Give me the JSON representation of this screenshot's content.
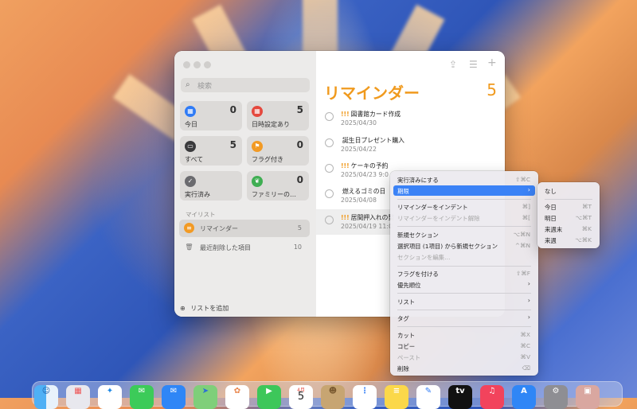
{
  "sidebar": {
    "search_placeholder": "検索",
    "cards": [
      {
        "label": "今日",
        "count": "0",
        "color": "#2f7bf6",
        "icon": "calendar-today-icon"
      },
      {
        "label": "日時設定あり",
        "count": "5",
        "color": "#e5483d",
        "icon": "calendar-icon"
      },
      {
        "label": "すべて",
        "count": "5",
        "color": "#3a3a3c",
        "icon": "tray-icon"
      },
      {
        "label": "フラグ付き",
        "count": "0",
        "color": "#f29a24",
        "icon": "flag-icon"
      },
      {
        "label": "実行済み",
        "count": "",
        "color": "#6b6b6f",
        "icon": "checkmark-icon"
      },
      {
        "label": "ファミリーの…",
        "count": "0",
        "color": "#3fae52",
        "icon": "leaf-icon"
      }
    ],
    "section_title": "マイリスト",
    "lists": [
      {
        "name": "リマインダー",
        "count": "5"
      },
      {
        "name": "最近削除した項目",
        "count": "10"
      }
    ],
    "add_list": "リストを追加"
  },
  "main": {
    "title": "リマインダー",
    "total": "5",
    "tasks": [
      {
        "priority": "!!!",
        "name": "図書館カード作成",
        "date": "2025/04/30"
      },
      {
        "priority": "",
        "name": "誕生日プレゼント購入",
        "date": "2025/04/22"
      },
      {
        "priority": "!!!",
        "name": "ケーキの予約",
        "date": "2025/04/23 9:0"
      },
      {
        "priority": "",
        "name": "燃えるゴミの日",
        "date": "2025/04/08"
      },
      {
        "priority": "!!!",
        "name": "居間押入れの整",
        "date": "2025/04/19 11:0"
      }
    ]
  },
  "context_menu": {
    "items": [
      {
        "label": "実行済みにする",
        "shortcut": "⇧⌘C"
      },
      {
        "label": "期限",
        "submenu": true
      },
      {
        "label": "リマインダーをインデント",
        "shortcut": "⌘]"
      },
      {
        "label": "リマインダーをインデント解除",
        "shortcut": "⌘[",
        "disabled": true
      },
      {
        "label": "新規セクション",
        "shortcut": "⌥⌘N"
      },
      {
        "label": "選択項目 (1項目) から新規セクション",
        "shortcut": "^⌘N"
      },
      {
        "label": "セクションを編集…",
        "disabled": true
      },
      {
        "label": "フラグを付ける",
        "shortcut": "⇧⌘F"
      },
      {
        "label": "優先順位",
        "submenu": true
      },
      {
        "label": "リスト",
        "submenu": true
      },
      {
        "label": "タグ",
        "submenu": true
      },
      {
        "label": "カット",
        "shortcut": "⌘X"
      },
      {
        "label": "コピー",
        "shortcut": "⌘C"
      },
      {
        "label": "ペースト",
        "shortcut": "⌘V",
        "disabled": true
      },
      {
        "label": "削除",
        "shortcut": "⌫"
      }
    ]
  },
  "submenu": {
    "items": [
      {
        "label": "なし",
        "shortcut": ""
      },
      {
        "label": "今日",
        "shortcut": "⌘T"
      },
      {
        "label": "明日",
        "shortcut": "⌥⌘T"
      },
      {
        "label": "来週末",
        "shortcut": "⌘K"
      },
      {
        "label": "来週",
        "shortcut": "⌥⌘K"
      }
    ]
  },
  "dock": {
    "calendar_month": "4月",
    "calendar_day": "5",
    "apps": [
      "finder-icon",
      "launchpad-icon",
      "safari-icon",
      "messages-icon",
      "mail-icon",
      "maps-icon",
      "photos-icon",
      "facetime-icon",
      "calendar-icon",
      "contacts-icon",
      "reminders-icon",
      "notes-icon",
      "freeform-icon",
      "tv-icon",
      "music-icon",
      "app-store-icon",
      "system-settings-icon",
      "preview-icon"
    ]
  }
}
